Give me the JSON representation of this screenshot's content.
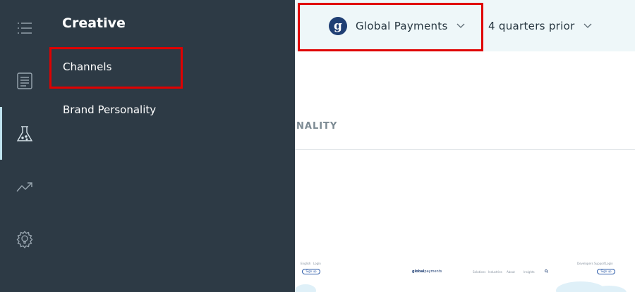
{
  "rail": {
    "items": [
      {
        "icon": "list-icon"
      },
      {
        "icon": "document-icon"
      },
      {
        "icon": "flask-icon",
        "active": true
      },
      {
        "icon": "trend-icon"
      },
      {
        "icon": "gear-bulb-icon"
      }
    ]
  },
  "menu": {
    "title": "Creative",
    "items": [
      {
        "label": "Channels"
      },
      {
        "label": "Brand Personality"
      }
    ]
  },
  "header": {
    "company_logo_letter": "g",
    "company_name": "Global Payments",
    "period": "4 quarters prior"
  },
  "content": {
    "tab_partial": "NALITY"
  },
  "thumbnail": {
    "brand_bold": "global",
    "brand_light": "payments",
    "top_left_links": [
      "English",
      "Login"
    ],
    "left_button": "Sign up",
    "nav_links": [
      "Solutions",
      "Industries",
      "About",
      "Insights"
    ],
    "top_right_links": [
      "Developers",
      "Support",
      "Login"
    ],
    "right_button": "Sign up"
  },
  "colors": {
    "sidebar_bg": "#2d3a45",
    "topbar_bg": "#eef7f9",
    "highlight": "#e00000",
    "logo_blue": "#1f3f74"
  }
}
